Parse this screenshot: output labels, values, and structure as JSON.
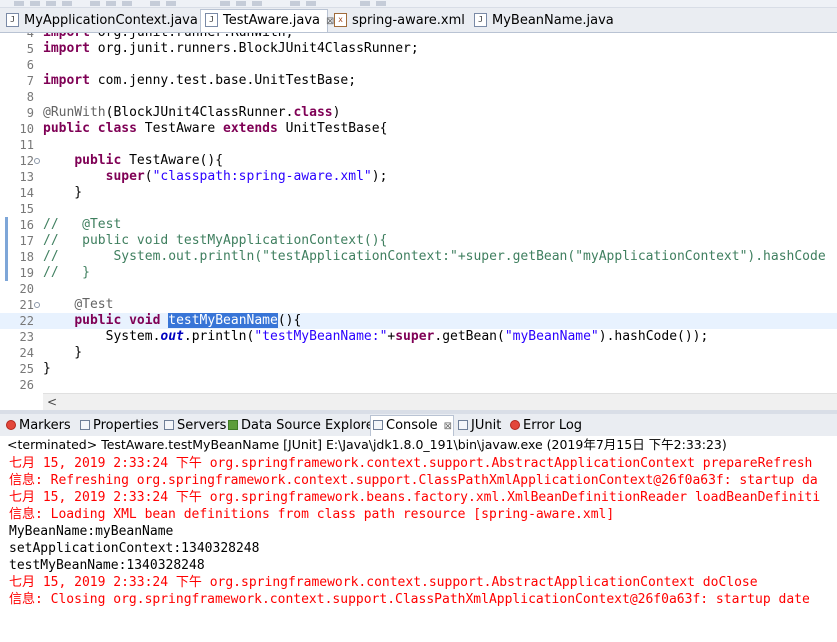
{
  "editor_tabs": [
    {
      "label": "MyApplicationContext.java",
      "icon": "java-file-icon",
      "active": false
    },
    {
      "label": "TestAware.java",
      "icon": "java-file-icon",
      "active": true,
      "close": "⊠"
    },
    {
      "label": "spring-aware.xml",
      "icon": "xml-file-icon",
      "active": false
    },
    {
      "label": "MyBeanName.java",
      "icon": "java-file-icon",
      "active": false
    }
  ],
  "code_lines": [
    {
      "n": "4",
      "html": "<span class=\"k\">import</span> org.junit.runner.RunWith;"
    },
    {
      "n": "5",
      "html": "<span class=\"k\">import</span> org.junit.runners.BlockJUnit4ClassRunner;"
    },
    {
      "n": "6",
      "html": ""
    },
    {
      "n": "7",
      "html": "<span class=\"k\">import</span> com.jenny.test.base.UnitTestBase;"
    },
    {
      "n": "8",
      "html": ""
    },
    {
      "n": "9",
      "html": "<span class=\"a\">@RunWith</span>(BlockJUnit4ClassRunner.<span class=\"k\">class</span>)"
    },
    {
      "n": "10",
      "html": "<span class=\"k\">public</span> <span class=\"k\">class</span> TestAware <span class=\"k\">extends</span> UnitTestBase{"
    },
    {
      "n": "11",
      "html": ""
    },
    {
      "n": "12",
      "fold": true,
      "html": "    <span class=\"k\">public</span> TestAware(){"
    },
    {
      "n": "13",
      "html": "        <span class=\"k\">super</span>(<span class=\"s\">\"classpath:spring-aware.xml\"</span>);"
    },
    {
      "n": "14",
      "html": "    }"
    },
    {
      "n": "15",
      "html": ""
    },
    {
      "n": "16",
      "mark": true,
      "html": "<span class=\"c\">//   @Test</span>"
    },
    {
      "n": "17",
      "mark": true,
      "html": "<span class=\"c\">//   public void testMyApplicationContext(){</span>"
    },
    {
      "n": "18",
      "mark": true,
      "html": "<span class=\"c\">//       System.out.println(\"testApplicationContext:\"+super.getBean(\"myApplicationContext\").hashCode</span>"
    },
    {
      "n": "19",
      "mark": true,
      "html": "<span class=\"c\">//   }</span>"
    },
    {
      "n": "20",
      "html": ""
    },
    {
      "n": "21",
      "fold": true,
      "html": "    <span class=\"a\">@Test</span>"
    },
    {
      "n": "22",
      "highlight": true,
      "html": "    <span class=\"k\">public</span> <span class=\"k\">void</span> <span class=\"sel\">testMyBeanName</span>(){"
    },
    {
      "n": "23",
      "html": "        System.<span class=\"f\">out</span>.println(<span class=\"s\">\"testMyBeanName:\"</span>+<span class=\"k\">super</span>.getBean(<span class=\"s\">\"myBeanName\"</span>).hashCode());"
    },
    {
      "n": "24",
      "html": "    }"
    },
    {
      "n": "25",
      "html": "}"
    },
    {
      "n": "26",
      "html": ""
    }
  ],
  "hscroll_arrow": "<",
  "panel_tabs": [
    {
      "label": "Markers",
      "icon": "markers-icon",
      "iconclass": "red"
    },
    {
      "label": "Properties",
      "icon": "properties-icon",
      "iconclass": ""
    },
    {
      "label": "Servers",
      "icon": "servers-icon",
      "iconclass": ""
    },
    {
      "label": "Data Source Explorer",
      "icon": "data-source-explorer-icon",
      "iconclass": "green"
    },
    {
      "label": "Console",
      "icon": "console-icon",
      "iconclass": "",
      "active": true,
      "close": "⊠"
    },
    {
      "label": "JUnit",
      "icon": "junit-icon",
      "iconclass": ""
    },
    {
      "label": "Error Log",
      "icon": "error-log-icon",
      "iconclass": "red"
    }
  ],
  "console_header": "<terminated> TestAware.testMyBeanName [JUnit] E:\\Java\\jdk1.8.0_191\\bin\\javaw.exe (2019年7月15日 下午2:33:23)",
  "console_lines": [
    {
      "kind": "err",
      "text": "七月 15, 2019 2:33:24 下午 org.springframework.context.support.AbstractApplicationContext prepareRefresh"
    },
    {
      "kind": "err",
      "text": "信息: Refreshing org.springframework.context.support.ClassPathXmlApplicationContext@26f0a63f: startup da"
    },
    {
      "kind": "err",
      "text": "七月 15, 2019 2:33:24 下午 org.springframework.beans.factory.xml.XmlBeanDefinitionReader loadBeanDefiniti"
    },
    {
      "kind": "err",
      "text": "信息: Loading XML bean definitions from class path resource [spring-aware.xml]"
    },
    {
      "kind": "out",
      "text": "MyBeanName:myBeanName"
    },
    {
      "kind": "out",
      "text": "setApplicationContext:1340328248"
    },
    {
      "kind": "out",
      "text": "testMyBeanName:1340328248"
    },
    {
      "kind": "err",
      "text": "七月 15, 2019 2:33:24 下午 org.springframework.context.support.AbstractApplicationContext doClose"
    },
    {
      "kind": "err",
      "text": "信息: Closing org.springframework.context.support.ClassPathXmlApplicationContext@26f0a63f: startup date"
    }
  ]
}
